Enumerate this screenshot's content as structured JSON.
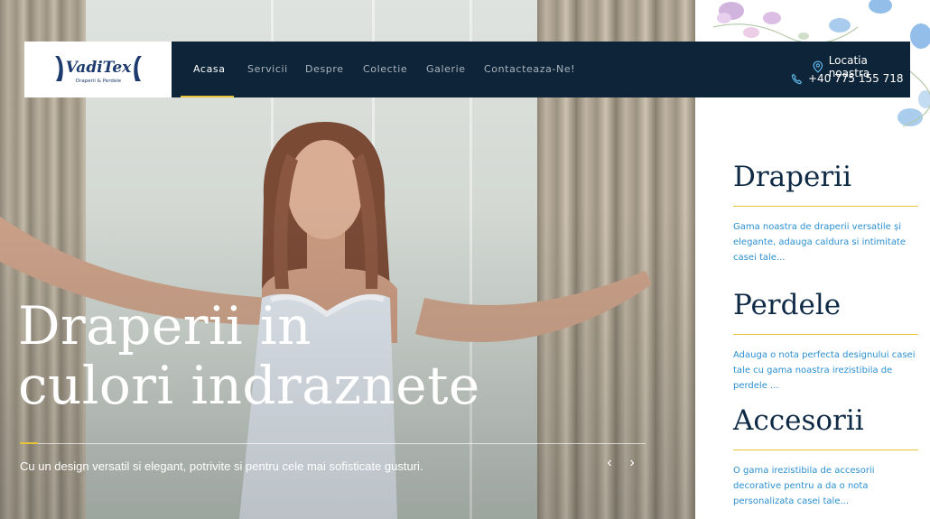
{
  "brand": {
    "name": "VadiTex",
    "tagline": "Draperii & Perdele",
    "navy": "#0e2438",
    "accent": "#e8c33a",
    "link_blue": "#2b8fd0"
  },
  "nav": {
    "items": [
      {
        "label": "Acasa",
        "active": true
      },
      {
        "label": "Servicii",
        "active": false
      },
      {
        "label": "Despre",
        "active": false
      },
      {
        "label": "Colectie",
        "active": false
      },
      {
        "label": "Galerie",
        "active": false
      },
      {
        "label": "Contacteaza-Ne!",
        "active": false
      }
    ],
    "location_label": "Locatia noastra",
    "phone": "+40 775 155 718",
    "location_icon": "map-pin-icon",
    "phone_icon": "phone-icon"
  },
  "hero": {
    "title_line1": "Draperii in",
    "title_line2": "culori indraznete",
    "subtitle": "Cu un design versatil si elegant, potrivite si pentru cele mai sofisticate gusturi.",
    "prev_icon": "chevron-left-icon",
    "next_icon": "chevron-right-icon",
    "prev_glyph": "‹",
    "next_glyph": "›"
  },
  "sidebar": {
    "sections": [
      {
        "title": "Draperii",
        "text": "Gama noastra de draperii versatile și elegante, adauga caldura si intimitate casei tale..."
      },
      {
        "title": "Perdele",
        "text": "Adauga o nota perfecta designului casei tale cu gama noastra irezistibila de perdele ..."
      },
      {
        "title": "Accesorii",
        "text": "O gama irezistibila de accesorii decorative pentru a da o nota personalizata casei tale..."
      }
    ]
  }
}
